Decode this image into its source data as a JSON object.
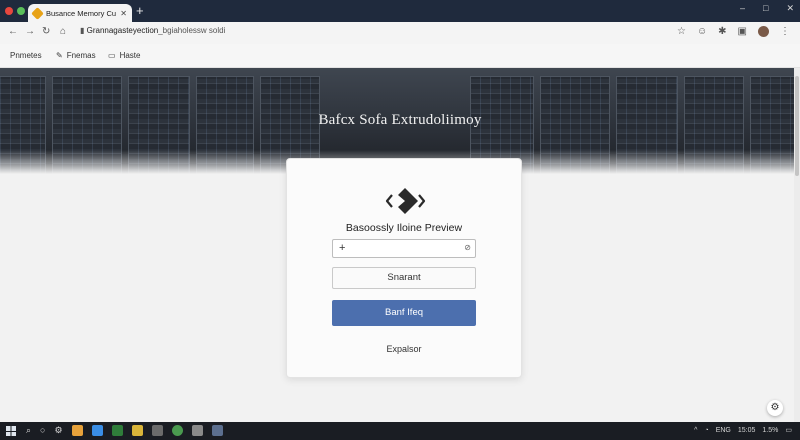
{
  "browser": {
    "tab_title": "Busance Memory Cuscey",
    "tab_close": "✕",
    "new_tab": "+",
    "url_host": "Grannagasteyection",
    "url_path": "_bgiaholessw soldi",
    "window_controls": [
      "–",
      "□",
      "✕"
    ]
  },
  "bookmarks": [
    {
      "label": "Pnmetes",
      "icon": "none"
    },
    {
      "label": "Fnemas",
      "icon": "puzzle-icon"
    },
    {
      "label": "Haste",
      "icon": "monitor-icon"
    }
  ],
  "hero": {
    "title": "Bafcx Sofa Extrudoliimoy"
  },
  "card": {
    "title": "Basoossly Iloine Preview",
    "search_icon": "+",
    "search_trailing_icon": "⊘",
    "search_placeholder": "",
    "secondary_button": "Snarant",
    "primary_button": "Banf Ifeq",
    "link": "Expalsor"
  },
  "taskbar": {
    "tray_lang": "ENG",
    "tray_time": "15:05",
    "tray_battery": "1.5%"
  },
  "colors": {
    "accent_button": "#4c6fae",
    "titlebar": "#1f2a3d",
    "taskbar": "#1a1d23",
    "favicon": "#e8a317"
  }
}
